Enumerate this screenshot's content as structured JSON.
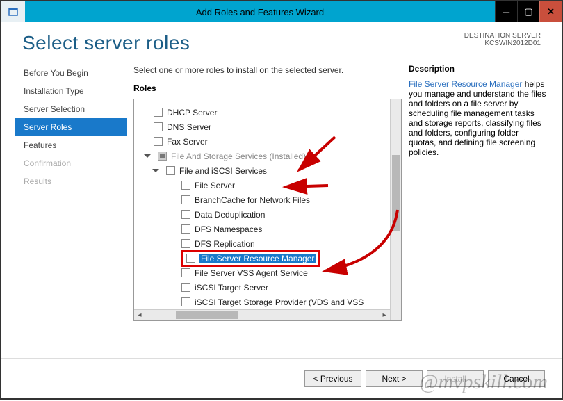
{
  "window": {
    "title": "Add Roles and Features Wizard"
  },
  "header": {
    "title": "Select server roles",
    "dest_label": "DESTINATION SERVER",
    "dest_value": "KCSWIN2012D01"
  },
  "nav": [
    {
      "label": "Before You Begin",
      "state": "normal"
    },
    {
      "label": "Installation Type",
      "state": "normal"
    },
    {
      "label": "Server Selection",
      "state": "normal"
    },
    {
      "label": "Server Roles",
      "state": "selected"
    },
    {
      "label": "Features",
      "state": "normal"
    },
    {
      "label": "Confirmation",
      "state": "dim"
    },
    {
      "label": "Results",
      "state": "dim"
    }
  ],
  "center": {
    "intro": "Select one or more roles to install on the selected server.",
    "roles_heading": "Roles",
    "roles": [
      {
        "label": "DHCP Server",
        "lvl": 1,
        "chk": "unchecked"
      },
      {
        "label": "DNS Server",
        "lvl": 1,
        "chk": "unchecked"
      },
      {
        "label": "Fax Server",
        "lvl": 1,
        "chk": "unchecked"
      },
      {
        "label": "File And Storage Services (Installed)",
        "lvl": 1,
        "chk": "installed",
        "exp": true,
        "disabled": true
      },
      {
        "label": "File and iSCSI Services",
        "lvl": 2,
        "chk": "unchecked",
        "exp": true
      },
      {
        "label": "File Server",
        "lvl": 3,
        "chk": "unchecked"
      },
      {
        "label": "BranchCache for Network Files",
        "lvl": 3,
        "chk": "unchecked"
      },
      {
        "label": "Data Deduplication",
        "lvl": 3,
        "chk": "unchecked"
      },
      {
        "label": "DFS Namespaces",
        "lvl": 3,
        "chk": "unchecked"
      },
      {
        "label": "DFS Replication",
        "lvl": 3,
        "chk": "unchecked"
      },
      {
        "label": "File Server Resource Manager",
        "lvl": 3,
        "chk": "unchecked",
        "highlight": true
      },
      {
        "label": "File Server VSS Agent Service",
        "lvl": 3,
        "chk": "unchecked"
      },
      {
        "label": "iSCSI Target Server",
        "lvl": 3,
        "chk": "unchecked"
      },
      {
        "label": "iSCSI Target Storage Provider (VDS and VSS",
        "lvl": 3,
        "chk": "unchecked"
      }
    ]
  },
  "description": {
    "heading": "Description",
    "link_text": "File Server Resource Manager",
    "body_rest": " helps you manage and understand the files and folders on a file server by scheduling file management tasks and storage reports, classifying files and folders, configuring folder quotas, and defining file screening policies."
  },
  "footer": {
    "previous": "< Previous",
    "next": "Next >",
    "install": "Install",
    "cancel": "Cancel"
  },
  "watermark": "@mvpskill.com"
}
